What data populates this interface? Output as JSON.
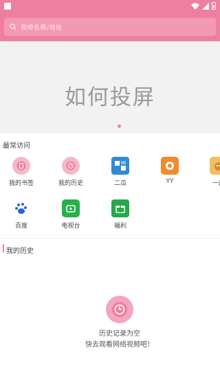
{
  "header": {
    "search_placeholder": "视频名称/地址"
  },
  "hero": {
    "title": "如何投屏"
  },
  "frequent": {
    "title": "最常访问",
    "items": [
      {
        "label": "我的书签",
        "icon": "bookmark-icon",
        "color": "#ef7fa0"
      },
      {
        "label": "我的历史",
        "icon": "history-icon",
        "color": "#ef7fa0"
      },
      {
        "label": "二瓜",
        "icon": "erggua-icon",
        "color": "#3b8fd9"
      },
      {
        "label": "YY",
        "icon": "yy-icon",
        "color": "#f08b2e"
      },
      {
        "label": "一起",
        "icon": "yiqi-icon",
        "color": "#d98a2b"
      },
      {
        "label": "百度",
        "icon": "baidu-icon",
        "color": "#2b62d9"
      },
      {
        "label": "电视台",
        "icon": "tv-icon",
        "color": "#27b04a"
      },
      {
        "label": "福利",
        "icon": "gift-icon",
        "color": "#27a84a"
      }
    ]
  },
  "history": {
    "title": "我的历史",
    "empty_line1": "历史记录为空",
    "empty_line2": "快去观看网络视频吧！"
  },
  "colors": {
    "accent": "#ef7fa0"
  }
}
